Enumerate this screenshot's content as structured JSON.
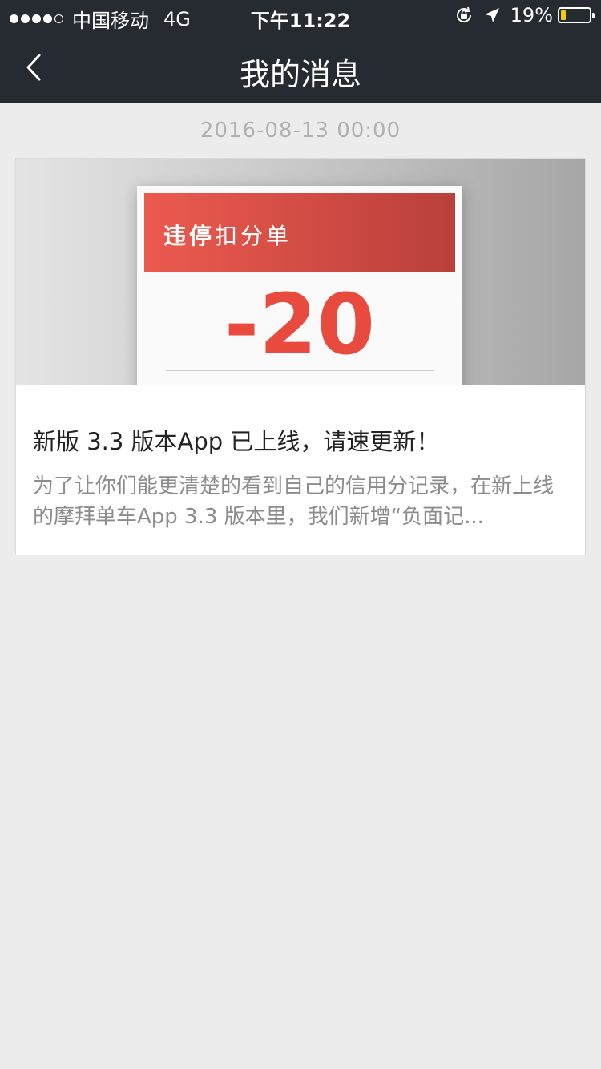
{
  "status_bar": {
    "carrier": "中国移动",
    "network": "4G",
    "time": "下午11:22",
    "battery": "19%",
    "battery_level": 0.19,
    "signal_bars": 4,
    "signal_max": 5
  },
  "nav": {
    "title": "我的消息",
    "back_icon": "chevron-left-icon"
  },
  "messages": [
    {
      "timestamp": "2016-08-13  00:00",
      "image": {
        "header_bold": "违停",
        "header_normal": "扣分单",
        "number": "-20"
      },
      "title": "新版 3.3 版本App 已上线，请速更新！",
      "description": "为了让你们能更清楚的看到自己的信用分记录，在新上线的摩拜单车App 3.3 版本里，我们新增“负面记..."
    }
  ],
  "colors": {
    "nav_background": "#262a31",
    "page_background": "#ececec",
    "accent_red": "#e84b3e",
    "battery_yellow": "#f5c518"
  }
}
